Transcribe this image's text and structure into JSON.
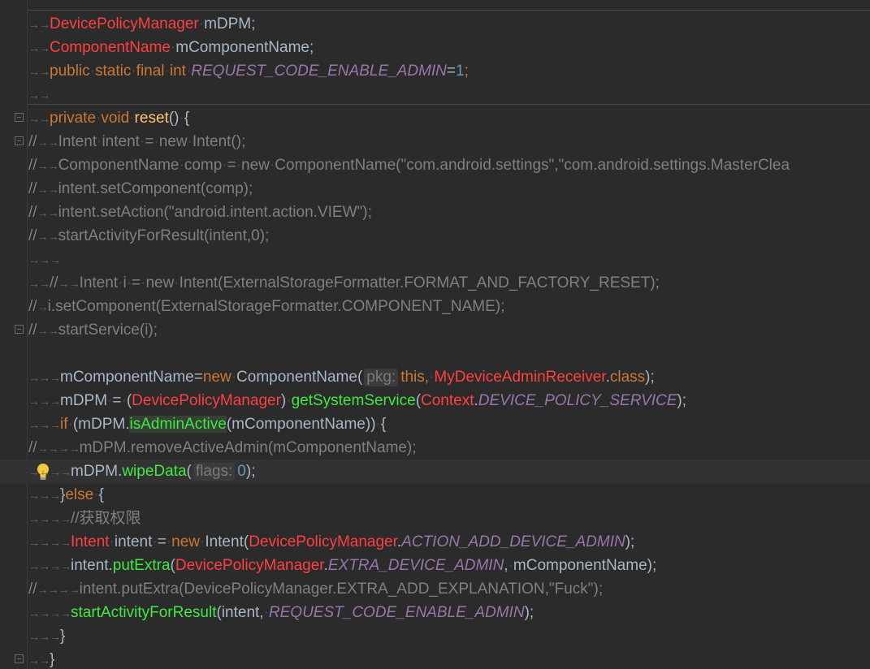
{
  "editor": {
    "lines": [
      "DevicePolicyManager mDPM;",
      "ComponentName mComponentName;",
      "public static final int REQUEST_CODE_ENABLE_ADMIN=1;",
      "private void reset() {",
      "Intent intent = new Intent();",
      "ComponentName comp = new ComponentName(\"com.android.settings\",\"com.android.settings.MasterClea",
      "intent.setComponent(comp);",
      "intent.setAction(\"android.intent.action.VIEW\");",
      "startActivityForResult(intent,0);",
      "Intent i = new Intent(ExternalStorageFormatter.FORMAT_AND_FACTORY_RESET);",
      "i.setComponent(ExternalStorageFormatter.COMPONENT_NAME);",
      "startService(i);",
      "mComponentName=new ComponentName( pkg: this, MyDeviceAdminReceiver.class);",
      "mDPM = (DevicePolicyManager) getSystemService(Context.DEVICE_POLICY_SERVICE);",
      "if (mDPM.isAdminActive(mComponentName)) {",
      "mDPM.removeActiveAdmin(mComponentName);",
      "mDPM.wipeData( flags: 0);",
      "}else {",
      "//获取权限",
      "Intent intent = new Intent(DevicePolicyManager.ACTION_ADD_DEVICE_ADMIN);",
      "intent.putExtra(DevicePolicyManager.EXTRA_DEVICE_ADMIN, mComponentName);",
      "intent.putExtra(DevicePolicyManager.EXTRA_ADD_EXPLANATION,\"Fuck\");",
      "startActivityForResult(intent, REQUEST_CODE_ENABLE_ADMIN);",
      "}",
      "}"
    ],
    "tokens": {
      "comment_prefix": "//",
      "tab_arrow": "→",
      "space_dot": "·",
      "hint_pkg": "pkg:",
      "hint_flags": "flags:"
    },
    "colors": {
      "background": "#2b2b2b",
      "keyword": "#cc7832",
      "text": "#a9b7c6",
      "red_error": "#ff4040",
      "static_field": "#9876aa",
      "number": "#6897bb",
      "string": "#6a8759",
      "method_declaration": "#ffc66d",
      "comment": "#808080",
      "method_call": "#43e843"
    },
    "icons": [
      "fold-icon",
      "lightbulb-icon"
    ]
  }
}
